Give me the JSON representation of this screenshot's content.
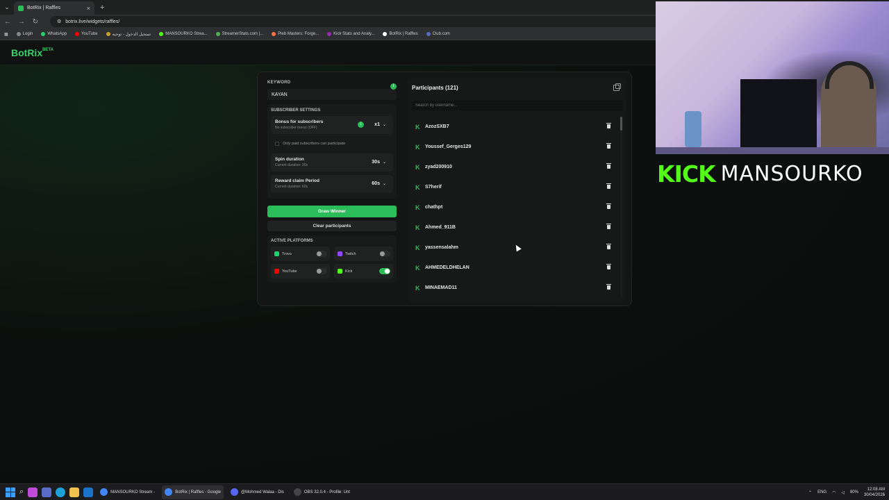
{
  "browser": {
    "tab_title": "BotRix | Raffles",
    "tab_close": "×",
    "new_tab": "+",
    "url": "botrix.live/widgets/raffles/",
    "bookmarks": [
      {
        "label": "Login",
        "color": "#888888"
      },
      {
        "label": "WhatsApp",
        "color": "#25d366"
      },
      {
        "label": "YouTube",
        "color": "#ff0000"
      },
      {
        "label": "تسجيل الدخول - توجيه",
        "color": "#c9a227"
      },
      {
        "label": "MANSOURKO Strea...",
        "color": "#53fc18"
      },
      {
        "label": "StreamerStats.com |...",
        "color": "#4caf50"
      },
      {
        "label": "Pleb Masters: Forge...",
        "color": "#ff7043"
      },
      {
        "label": "Kick Stats and Analy...",
        "color": "#9c27b0"
      },
      {
        "label": "BotRix | Raffles",
        "color": "#ffffff"
      },
      {
        "label": "Club.com",
        "color": "#5c6bc0"
      }
    ]
  },
  "app": {
    "logo": "BotRix",
    "logo_badge": "BETA"
  },
  "raffle": {
    "keyword_label": "KEYWORD",
    "keyword_info": "i",
    "keyword_value": "KAYAN",
    "subscriber_settings_label": "SUBSCRIBER SETTINGS",
    "bonus_title": "Bonus for subscribers",
    "bonus_sub": "No subscriber bonus (OFF)",
    "bonus_info": "i",
    "bonus_value": "x1",
    "only_paid_label": "Only paid subscribers can participate",
    "spin_title": "Spin duration",
    "spin_sub": "Current duration: 30s",
    "spin_value": "30s",
    "reward_title": "Reward claim Period",
    "reward_sub": "Current duration: 60s",
    "reward_value": "60s",
    "chevron": "⌄",
    "draw_button": "Draw Winner",
    "clear_button": "Clear participants",
    "active_platforms_label": "ACTIVE PLATFORMS",
    "platforms": [
      {
        "name": "Trovo",
        "color": "#19d66b",
        "enabled": false
      },
      {
        "name": "Twitch",
        "color": "#9146ff",
        "enabled": false
      },
      {
        "name": "YouTube",
        "color": "#ff0000",
        "enabled": false
      },
      {
        "name": "Kick",
        "color": "#53fc18",
        "enabled": true
      }
    ]
  },
  "participants": {
    "title": "Participants (121)",
    "search_placeholder": "Search by username...",
    "kick_glyph": "K",
    "list": [
      "AzozSXB7",
      "Youssef_Gerges129",
      "zyad200910",
      "S7herif",
      "chathpt",
      "Ahmed_911B",
      "yassensalahm",
      "AHMEDELDHELAN",
      "MINAEMAD11"
    ]
  },
  "stream_overlay": {
    "platform_word": "KICK",
    "streamer_name": "MANSOURKO"
  },
  "taskbar": {
    "apps": [
      {
        "label": "MANSOURKO Stream -",
        "color": "#4285f4",
        "active": false
      },
      {
        "label": "BotRix | Raffles - Google",
        "color": "#4285f4",
        "active": true
      },
      {
        "label": "@Mohmed Walaa - Dis",
        "color": "#5865f2",
        "active": false
      },
      {
        "label": "OBS 32.0.4 - Profile: Unt",
        "color": "#444444",
        "active": false
      }
    ],
    "language": "ENG",
    "battery": "80%",
    "time": "12:08 AM",
    "date": "30/04/2026"
  },
  "colors": {
    "accent": "#2bbd59",
    "kick_green": "#53fc18"
  }
}
